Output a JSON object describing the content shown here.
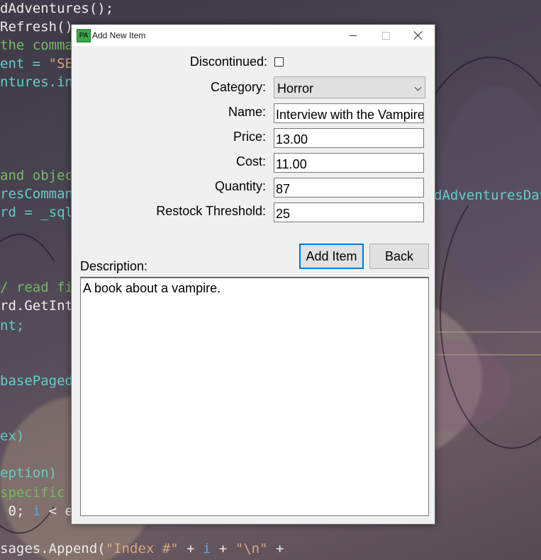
{
  "background_code": {
    "lines": [
      {
        "parts": [
          {
            "text": "dAdventures();",
            "color": "white"
          }
        ]
      },
      {
        "parts": [
          {
            "text": "Refresh()",
            "color": "white"
          }
        ]
      },
      {
        "parts": [
          {
            "text": "the comma",
            "color": "green"
          }
        ]
      },
      {
        "parts": [
          {
            "text": "ent = ",
            "color": "cyan"
          },
          {
            "text": "\"SE",
            "color": "orange"
          }
        ]
      },
      {
        "parts": [
          {
            "text": "ntures.in",
            "color": "cyan"
          }
        ]
      },
      {
        "parts": [
          {
            "text": "and objec",
            "color": "green"
          }
        ]
      },
      {
        "parts": [
          {
            "text": "resComman",
            "color": "cyan"
          }
        ]
      },
      {
        "parts": [
          {
            "text": "rd = _sql",
            "color": "cyan"
          }
        ]
      },
      {
        "parts": [
          {
            "text": "/ read fi",
            "color": "green"
          }
        ]
      },
      {
        "parts": [
          {
            "text": "rd.GetInt",
            "color": "white"
          }
        ]
      },
      {
        "parts": [
          {
            "text": "nt;",
            "color": "cyan"
          }
        ]
      },
      {
        "parts": [
          {
            "text": "basePaged",
            "color": "cyan"
          }
        ]
      },
      {
        "parts": [
          {
            "text": "ex)",
            "color": "cyan"
          }
        ]
      },
      {
        "parts": [
          {
            "text": "eption)",
            "color": "cyan"
          }
        ]
      },
      {
        "parts": [
          {
            "text": "specific",
            "color": "green"
          }
        ]
      },
      {
        "parts": [
          {
            "text": " 0; ",
            "color": "white"
          },
          {
            "text": "i",
            "color": "blue"
          },
          {
            "text": " < e",
            "color": "white"
          }
        ]
      },
      {
        "parts": [
          {
            "text": "sages.Append(",
            "color": "white"
          },
          {
            "text": "\"Index #\"",
            "color": "orange"
          },
          {
            "text": " + ",
            "color": "white"
          },
          {
            "text": "i",
            "color": "blue"
          },
          {
            "text": " + ",
            "color": "white"
          },
          {
            "text": "\"\\n\"",
            "color": "orange"
          },
          {
            "text": " +",
            "color": "white"
          }
        ]
      }
    ],
    "right_fragment": "dAdventuresDat"
  },
  "window": {
    "icon_text": "PA",
    "title": "Add New Item"
  },
  "form": {
    "discontinued_label": "Discontinued:",
    "discontinued_checked": false,
    "category_label": "Category:",
    "category_value": "Horror",
    "name_label": "Name:",
    "name_value": "Interview with the Vampire",
    "price_label": "Price:",
    "price_value": "13.00",
    "cost_label": "Cost:",
    "cost_value": "11.00",
    "quantity_label": "Quantity:",
    "quantity_value": "87",
    "restock_label": "Restock Threshold:",
    "restock_value": "25",
    "description_label": "Description:",
    "description_value": "A book about a vampire."
  },
  "buttons": {
    "add_label": "Add Item",
    "back_label": "Back"
  },
  "colors": {
    "accent": "#0078d7",
    "icon_green": "#3ca64a"
  }
}
